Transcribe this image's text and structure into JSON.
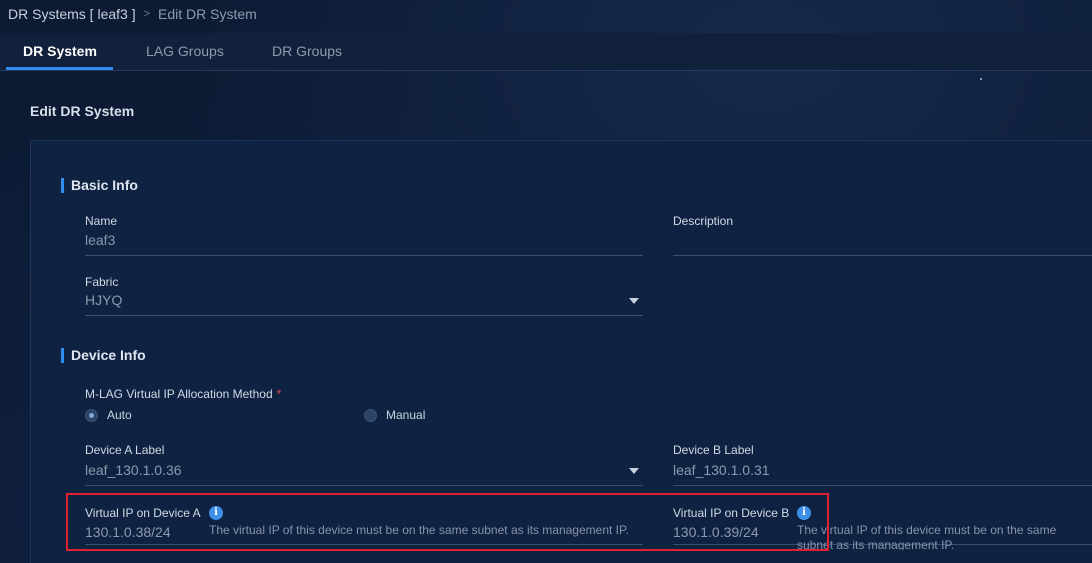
{
  "breadcrumb": {
    "parent": "DR Systems [ leaf3 ]",
    "separator": ">",
    "current": "Edit DR System"
  },
  "tabs": [
    {
      "label": "DR System",
      "active": true
    },
    {
      "label": "LAG Groups",
      "active": false
    },
    {
      "label": "DR Groups",
      "active": false
    }
  ],
  "page_title": "Edit DR System",
  "basic_info": {
    "title": "Basic Info",
    "name_label": "Name",
    "name_value": "leaf3",
    "description_label": "Description",
    "description_value": "",
    "fabric_label": "Fabric",
    "fabric_value": "HJYQ"
  },
  "device_info": {
    "title": "Device Info",
    "method_label": "M-LAG Virtual IP Allocation Method",
    "required_mark": "*",
    "options": [
      "Auto",
      "Manual"
    ],
    "selected_option": "Auto",
    "device_a_label": "Device A Label",
    "device_a_value": "leaf_130.1.0.36",
    "device_b_label": "Device B Label",
    "device_b_value": "leaf_130.1.0.31",
    "vip_a_label": "Virtual IP on Device A",
    "vip_a_value": "130.1.0.38/24",
    "vip_a_hint": "The virtual IP of this device must be on the same subnet as its management IP.",
    "vip_b_label": "Virtual IP on Device B",
    "vip_b_value": "130.1.0.39/24",
    "vip_b_hint": "The virtual IP of this device must be on the same subnet as its management IP."
  },
  "colors": {
    "accent": "#2f8df0",
    "highlight": "#e0202e",
    "background": "#0c1a33"
  },
  "icons": {
    "info": "info-icon",
    "dropdown": "chevron-down-icon"
  }
}
